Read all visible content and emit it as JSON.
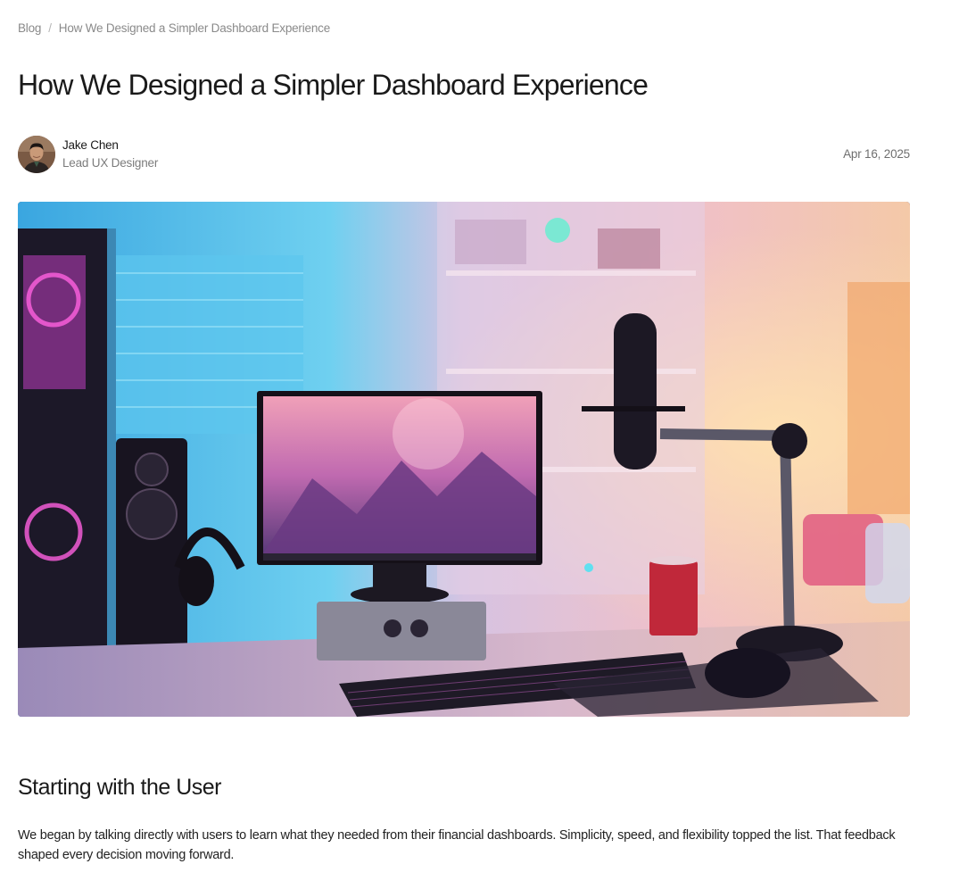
{
  "breadcrumb": {
    "root": "Blog",
    "separator": "/",
    "current": "How We Designed a Simpler Dashboard Experience"
  },
  "article": {
    "title": "How We Designed a Simpler Dashboard Experience",
    "author": {
      "name": "Jake Chen",
      "role": "Lead UX Designer"
    },
    "date": "Apr 16, 2025",
    "hero_image": "desk-setup-photo",
    "section": {
      "heading": "Starting with the User",
      "paragraph": "We began by talking directly with users to learn what they needed from their financial dashboards. Simplicity, speed, and flexibility topped the list. That feedback shaped every decision moving forward."
    }
  },
  "colors": {
    "text_primary": "#1a1a1a",
    "text_muted": "#8a8a8a",
    "background": "#ffffff"
  }
}
